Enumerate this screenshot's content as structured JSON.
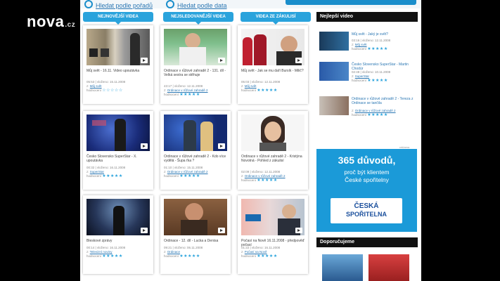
{
  "logo": {
    "name": "nova",
    "tld": ".cz"
  },
  "top": {
    "link1": "Hledat podle pořadů",
    "link2": "Hledat podle data"
  },
  "columns": [
    {
      "head": "NEJNOVĚJŠÍ VIDEA",
      "cards": [
        {
          "title": "Můj svět - 16.11. Video upoutávka",
          "meta1": "05:53 | vloženo: 15.11.2008",
          "meta2": "Můj svět",
          "meta3": "hodnocení"
        },
        {
          "title": "Česko Slovensko SuperStar - X. upoutávka",
          "meta1": "00:32 | vloženo: 16.11.2008",
          "meta2": "SuperStar",
          "meta3": "hodnocení"
        },
        {
          "title": "Bleskové zprávy",
          "meta1": "00:14 | vloženo: 16.11.2008",
          "meta2": "Televizní noviny",
          "meta3": "hodnocení"
        }
      ]
    },
    {
      "head": "NEJSLEDOVANĚJŠÍ VIDEA",
      "cards": [
        {
          "title": "Ordinace v růžové zahradě 2 - 131. díl - Velká sestra se stěhuje",
          "meta1": "43:17 | vloženo: 12.11.2008",
          "meta2": "Ordinace v růžové zahradě 2",
          "meta3": "hodnocení"
        },
        {
          "title": "Ordinace v růžové zahradě 2 - Kdo více vydělá - Šupa ťka ?",
          "meta1": "01:10 | vloženo: 15.11.2008",
          "meta2": "Ordinace v růžové zahradě 2",
          "meta3": "hodnocení"
        },
        {
          "title": "Ordinace - 12. díl - Lucka a Denisa",
          "meta1": "09:21 | vloženo: 06.11.2008",
          "meta2": "Ordinace",
          "meta3": "hodnocení"
        }
      ]
    },
    {
      "head": "VIDEA ZE ZÁKULISÍ",
      "cards": [
        {
          "title": "Můj svět - Jak se mu daří Bursík - Milič?",
          "meta1": "05:03 | vloženo: 12.11.2008",
          "meta2": "Můj svět",
          "meta3": "hodnocení"
        },
        {
          "title": "Ordinace v růžové zahradě 2 - Kristýna Novotná - Pohled z zákulisí",
          "meta1": "02:09 | vloženo: 12.11.2008",
          "meta2": "Ordinace v růžové zahradě 2",
          "meta3": "hodnocení"
        },
        {
          "title": "Počasí na Nově 16.11.2008 - předpověď počasí",
          "meta1": "01:22 | vloženo: 16.11.2008",
          "meta2": "Počasí na Nově",
          "meta3": "hodnocení"
        }
      ]
    }
  ],
  "right": {
    "head": "Nejlepší video",
    "items": [
      {
        "title": "Můj svět - Jaký je svět?",
        "meta1": "03:16 | vloženo: 12.11.2008",
        "meta2": "Můj svět",
        "meta3": "hodnocení"
      },
      {
        "title": "Česko Slovensko SuperStar - Martin Chodúr",
        "meta1": "02:48 | vloženo: 10.11.2008",
        "meta2": "SuperStar",
        "meta3": "hodnocení"
      },
      {
        "title": "Ordinace v růžové zahradě 2 - Tereza z Ordinace se tančila",
        "meta1": "01:49 | vloženo: 12.11.2008",
        "meta2": "Ordinace v růžové zahradě 2",
        "meta3": "hodnocení"
      }
    ],
    "ad_label": "reklama",
    "ad": {
      "line1": "365 důvodů,",
      "line2": "proč být klientem",
      "line3": "České spořitelny",
      "brand1": "ČESKÁ",
      "brand2": "SPOŘITELNA"
    },
    "rec_head": "Doporučujeme"
  },
  "colors": {
    "accent": "#2aa3dc",
    "link": "#2b77b3",
    "ad": "#1b9ad8"
  }
}
